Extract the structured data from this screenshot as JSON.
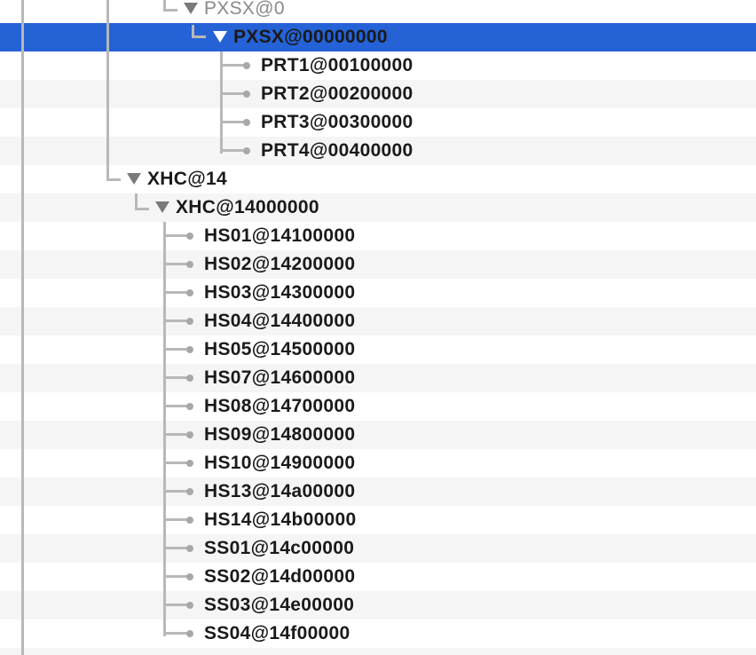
{
  "tree": {
    "rows": [
      {
        "id": "pxsx-0",
        "label": "PXSX@0",
        "selected": false,
        "expanded": true
      },
      {
        "id": "pxsx-00000000",
        "label": "PXSX@00000000",
        "selected": true,
        "expanded": true
      },
      {
        "id": "prt1",
        "label": "PRT1@00100000",
        "selected": false
      },
      {
        "id": "prt2",
        "label": "PRT2@00200000",
        "selected": false
      },
      {
        "id": "prt3",
        "label": "PRT3@00300000",
        "selected": false
      },
      {
        "id": "prt4",
        "label": "PRT4@00400000",
        "selected": false
      },
      {
        "id": "xhc-14",
        "label": "XHC@14",
        "selected": false,
        "expanded": true
      },
      {
        "id": "xhc-14000000",
        "label": "XHC@14000000",
        "selected": false,
        "expanded": true
      },
      {
        "id": "hs01",
        "label": "HS01@14100000",
        "selected": false
      },
      {
        "id": "hs02",
        "label": "HS02@14200000",
        "selected": false
      },
      {
        "id": "hs03",
        "label": "HS03@14300000",
        "selected": false
      },
      {
        "id": "hs04",
        "label": "HS04@14400000",
        "selected": false
      },
      {
        "id": "hs05",
        "label": "HS05@14500000",
        "selected": false
      },
      {
        "id": "hs07",
        "label": "HS07@14600000",
        "selected": false
      },
      {
        "id": "hs08",
        "label": "HS08@14700000",
        "selected": false
      },
      {
        "id": "hs09",
        "label": "HS09@14800000",
        "selected": false
      },
      {
        "id": "hs10",
        "label": "HS10@14900000",
        "selected": false
      },
      {
        "id": "hs13",
        "label": "HS13@14a00000",
        "selected": false
      },
      {
        "id": "hs14",
        "label": "HS14@14b00000",
        "selected": false
      },
      {
        "id": "ss01",
        "label": "SS01@14c00000",
        "selected": false
      },
      {
        "id": "ss02",
        "label": "SS02@14d00000",
        "selected": false
      },
      {
        "id": "ss03",
        "label": "SS03@14e00000",
        "selected": false
      },
      {
        "id": "ss04",
        "label": "SS04@14f00000",
        "selected": false
      }
    ]
  },
  "colors": {
    "selection": "#2462d6",
    "stripe": "#f5f5f5",
    "tree_line": "#b8b8b8",
    "text": "#1a1a1a",
    "dim_text": "#8a8a8a"
  },
  "icons": {
    "expanded_row": "disclosure-triangle-down-icon",
    "leaf_row": "leaf-dot-icon"
  }
}
